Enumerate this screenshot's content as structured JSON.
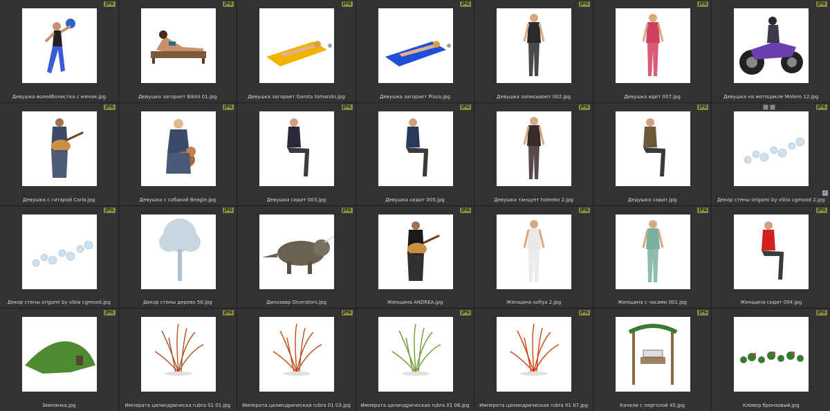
{
  "badge": "JPG",
  "extra_icons": [
    "frame-icon",
    "edit-icon"
  ],
  "items": [
    {
      "name": "Девушка волейболистка с мячом.jpg",
      "art": "volley",
      "color": "#3a5bd6"
    },
    {
      "name": "Девушка загорает Bikini 01.jpg",
      "art": "lounger",
      "color": "#7a5a3a"
    },
    {
      "name": "Девушка загорает Garota tomando.jpg",
      "art": "towel",
      "color": "#f0b400"
    },
    {
      "name": "Девушка загорает Plaza.jpg",
      "art": "towel",
      "color": "#1f4fd8"
    },
    {
      "name": "Девушка записывает 002.jpg",
      "art": "woman",
      "color": "#2a2a2a"
    },
    {
      "name": "Девушка идет 007.jpg",
      "art": "woman",
      "color": "#d04060"
    },
    {
      "name": "Девушка на мотоцикле Motero 12.jpg",
      "art": "moto",
      "color": "#6a3fb0"
    },
    {
      "name": "Девушка с гитарой Carla.jpg",
      "art": "guitar",
      "color": "#3a4a6a"
    },
    {
      "name": "Девушка с собакой Beagle.jpg",
      "art": "dog",
      "color": "#a06a3a"
    },
    {
      "name": "Девушка сидит 003.jpg",
      "art": "sit",
      "color": "#2a2a3a"
    },
    {
      "name": "Девушка сидит 005.jpg",
      "art": "sit",
      "color": "#2a3a5a"
    },
    {
      "name": "Девушка танцует hoineko 2.jpg",
      "art": "woman",
      "color": "#3a2a2a"
    },
    {
      "name": "Дедушка сидит.jpg",
      "art": "sit",
      "color": "#6a5a3a"
    },
    {
      "name": "Декор стены origami by vibia cgmood 2.jpg",
      "art": "origami",
      "color": "#cfe0ee"
    },
    {
      "name": "Декор стены origami by vibia cgmood.jpg",
      "art": "origami",
      "color": "#cfe0ee"
    },
    {
      "name": "Декор стены дерево 56.jpg",
      "art": "tree",
      "color": "#c8d6e2"
    },
    {
      "name": "Динозавр Dicerators.jpg",
      "art": "dino",
      "color": "#6a6050"
    },
    {
      "name": "Женщина ANDREA.jpg",
      "art": "guitar",
      "color": "#1a1a1a"
    },
    {
      "name": "Женщина sofiya 2.jpg",
      "art": "woman",
      "color": "#e8e8e8"
    },
    {
      "name": "Женщина с часами 001.jpg",
      "art": "woman",
      "color": "#7ab0a0"
    },
    {
      "name": "Женщина сидит 004.jpg",
      "art": "sit",
      "color": "#d02020"
    },
    {
      "name": "Землянка.jpg",
      "art": "mound",
      "color": "#4e8a30"
    },
    {
      "name": "Императа цилиндрическа rubra 01 01.jpg",
      "art": "grass",
      "color": "#b05020"
    },
    {
      "name": "Императа цилиндрическая rubra 01 03.jpg",
      "art": "grass",
      "color": "#c04a10"
    },
    {
      "name": "Императа цилиндрическая rubra 01 06.jpg",
      "art": "grass",
      "color": "#6a9a30"
    },
    {
      "name": "Императа цилиндрическая rubra 01 07.jpg",
      "art": "grass",
      "color": "#d04010"
    },
    {
      "name": "Качели с перголой 45.jpg",
      "art": "pergola",
      "color": "#8a6a40"
    },
    {
      "name": "Клевер бронзовый.jpg",
      "art": "clover",
      "color": "#3a7a30"
    }
  ]
}
